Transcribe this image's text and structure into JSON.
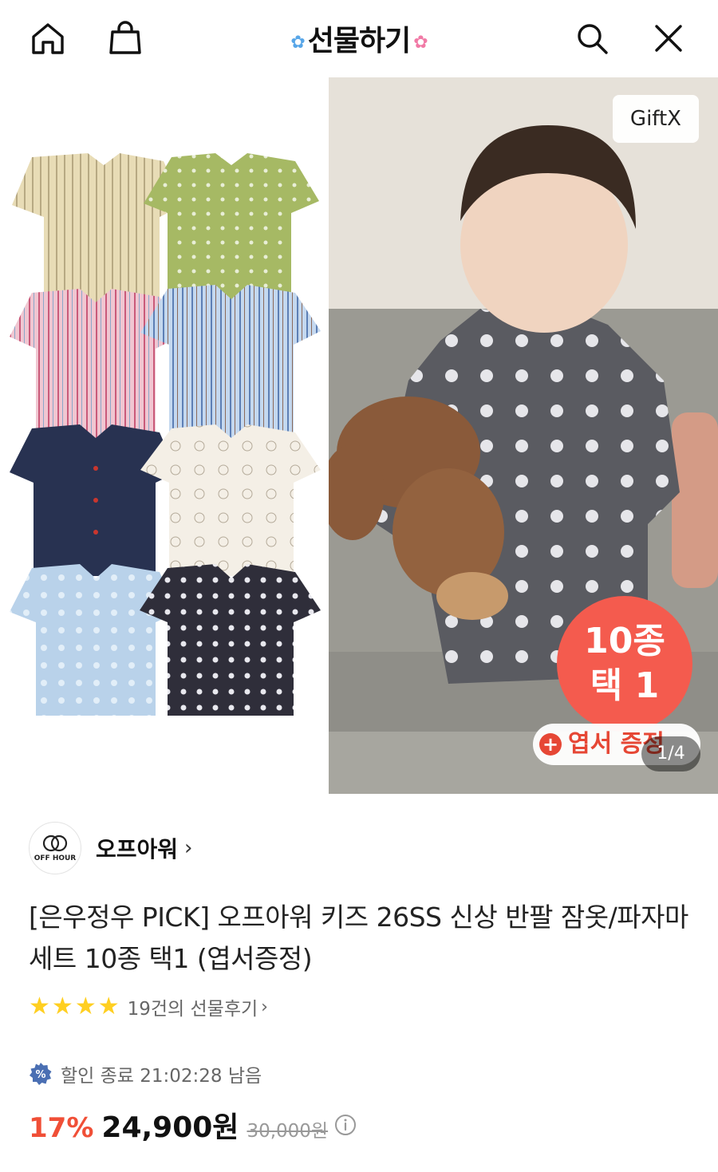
{
  "header": {
    "title": "선물하기",
    "icons": [
      "home-icon",
      "shopping-bag-icon",
      "search-icon",
      "close-icon"
    ]
  },
  "product_image": {
    "gift_badge": "GiftX",
    "promo_badge_line1": "10종",
    "promo_badge_line2": "택 1",
    "postcard_badge": "엽서 증정",
    "page_indicator": "1/4"
  },
  "brand": {
    "logo_text": "OFF HOUR",
    "name": "오프아워"
  },
  "product": {
    "title": "[은우정우 PICK] 오프아워 키즈 26SS 신상 반팔 잠옷/파자마 세트 10종 택1 (엽서증정)",
    "rating_stars": 4,
    "review_text": "19건의 선물후기"
  },
  "discount": {
    "timer_text": "할인 종료 21:02:28 남음"
  },
  "price": {
    "discount_rate": "17%",
    "sale_price": "24,900원",
    "original_price": "30,000원"
  },
  "colors": {
    "accent_red": "#f04f37",
    "star_yellow": "#ffcf21",
    "promo_badge": "#f45b4e",
    "timer_icon": "#4a6fb3"
  }
}
